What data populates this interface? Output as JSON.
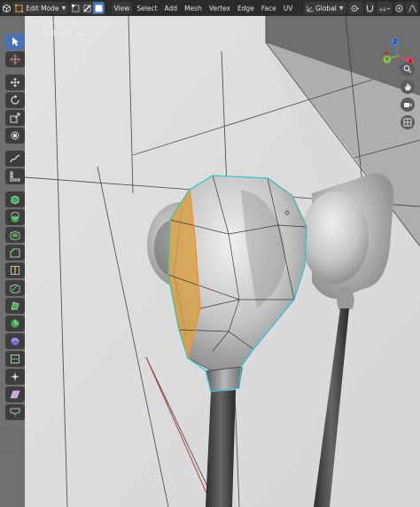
{
  "header": {
    "mode": "Edit Mode",
    "menus": [
      "View",
      "Select",
      "Add",
      "Mesh",
      "Vertex",
      "Edge",
      "Face",
      "UV"
    ],
    "transform_orientation": "Global"
  },
  "viewport": {
    "perspective_label": "User Perspective",
    "object_label": "(0) Box001.001"
  },
  "toolbar": {
    "tools": [
      {
        "name": "select-box-tool",
        "icon": "cursor-icon",
        "active": true
      },
      {
        "name": "cursor-tool",
        "icon": "3d-cursor-icon",
        "active": false
      },
      {
        "name": "move-tool",
        "icon": "move-arrows-icon",
        "active": false
      },
      {
        "name": "rotate-tool",
        "icon": "rotate-icon",
        "active": false
      },
      {
        "name": "scale-tool",
        "icon": "scale-icon",
        "active": false
      },
      {
        "name": "transform-tool",
        "icon": "transform-icon",
        "active": false
      },
      {
        "name": "annotate-tool",
        "icon": "annotate-icon",
        "active": false
      },
      {
        "name": "measure-tool",
        "icon": "ruler-icon",
        "active": false
      },
      {
        "name": "add-cube-tool",
        "icon": "add-cube-icon",
        "active": false
      },
      {
        "name": "extrude-tool",
        "icon": "extrude-icon",
        "active": false
      },
      {
        "name": "inset-tool",
        "icon": "inset-icon",
        "active": false
      },
      {
        "name": "bevel-tool",
        "icon": "bevel-icon",
        "active": false
      },
      {
        "name": "loop-cut-tool",
        "icon": "loop-cut-icon",
        "active": false
      },
      {
        "name": "knife-tool",
        "icon": "knife-icon",
        "active": false
      },
      {
        "name": "poly-build-tool",
        "icon": "poly-build-icon",
        "active": false
      },
      {
        "name": "spin-tool",
        "icon": "spin-icon",
        "active": false
      },
      {
        "name": "smooth-tool",
        "icon": "smooth-icon",
        "active": false
      },
      {
        "name": "edge-slide-tool",
        "icon": "edge-slide-icon",
        "active": false
      },
      {
        "name": "shrink-fatten-tool",
        "icon": "shrink-fatten-icon",
        "active": false
      },
      {
        "name": "shear-tool",
        "icon": "shear-icon",
        "active": false
      },
      {
        "name": "rip-tool",
        "icon": "rip-icon",
        "active": false
      }
    ]
  },
  "colors": {
    "accent": "#4772b3",
    "selection_orange": "#ff8c1a",
    "selection_cyan": "#27c6d6",
    "axis_x": "#e8445a",
    "axis_y": "#8bc34a",
    "axis_z": "#4a7fd8"
  },
  "gizmo": {
    "x_label": "X",
    "y_label": "Y",
    "z_label": "Z"
  }
}
